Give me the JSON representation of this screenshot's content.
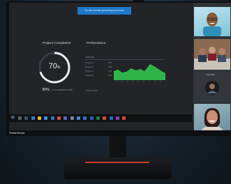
{
  "notification": {
    "text": "You are currently presenting your screen"
  },
  "dashboard": {
    "project_completion": {
      "title": "Project Completion",
      "percent": 70,
      "percent_label": "70",
      "percent_sign": "%",
      "secondary_value": "30%",
      "secondary_note": "OUT OF REMAINING WORK"
    },
    "performance": {
      "title": "Performance",
      "header": "OVERVIEW",
      "rows": [
        {
          "label": "Progress A",
          "value": "8 KB"
        },
        {
          "label": "Progress B",
          "value": "8 KB"
        },
        {
          "label": "Progress C",
          "value": "8 KB"
        },
        {
          "label": "Progress D",
          "value": "8 KB"
        }
      ],
      "x_ticks": [
        "10",
        "20",
        "30",
        "40",
        "50",
        "60",
        "70",
        "80",
        "90"
      ],
      "footer": "TOTAL ACCESS"
    }
  },
  "participants": [
    {
      "name": "",
      "kind": "video"
    },
    {
      "name": "",
      "kind": "video"
    },
    {
      "name": "Greg Martin",
      "kind": "avatar"
    },
    {
      "name": "",
      "kind": "video"
    }
  ],
  "brand": "ThinkVision",
  "colors": {
    "accent": "#1e78c8",
    "chart_green": "#2fb44a",
    "ring": "#e9ecee",
    "stand_light": "#e0442f"
  },
  "taskbar_icons": [
    "start-icon",
    "search-icon",
    "task-view-icon",
    "edge-icon",
    "file-explorer-icon",
    "store-icon",
    "mail-icon",
    "chrome-icon",
    "teams-icon",
    "settings-icon",
    "photos-icon",
    "calendar-icon",
    "word-icon",
    "excel-icon",
    "powerpoint-icon",
    "outlook-icon",
    "onenote-icon",
    "skype-icon"
  ]
}
